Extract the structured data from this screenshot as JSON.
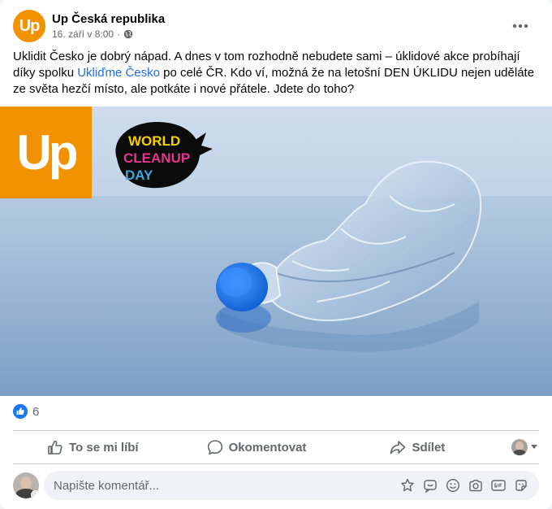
{
  "post": {
    "page_name": "Up Česká republika",
    "logo_text": "Up",
    "timestamp": "16. září v 8:00",
    "separator": "·",
    "audience_icon": "globe-icon",
    "more_icon": "more-horizontal-icon",
    "text_part1": "Uklidit Česko je dobrý nápad. A dnes v tom rozhodně nebudete sami – úklidové akce probíhají díky spolku ",
    "link_text": "Ukliďme Česko",
    "text_part2": " po celé ČR. Kdo ví, možná že na letošní DEN ÚKLIDU nejen uděláte ze světa hezčí místo, ale potkáte i nové přátele. Jdete do toho?"
  },
  "image": {
    "badge_text": "Up",
    "event_logo_line1": "WORLD",
    "event_logo_line2": "CLEANUP",
    "event_logo_line3": "DAY"
  },
  "reactions": {
    "icon": "like-reaction-icon",
    "count": "6"
  },
  "actions": {
    "like_label": "To se mi líbí",
    "comment_label": "Okomentovat",
    "share_label": "Sdílet"
  },
  "comment": {
    "placeholder": "Napište komentář...",
    "icons": [
      "avatar-sticker-icon",
      "comment-sticker-icon",
      "emoji-icon",
      "camera-icon",
      "gif-icon",
      "sticker-icon"
    ]
  },
  "colors": {
    "brand_orange": "#f39200",
    "link_blue": "#216fdb",
    "like_blue": "#1877f2"
  }
}
